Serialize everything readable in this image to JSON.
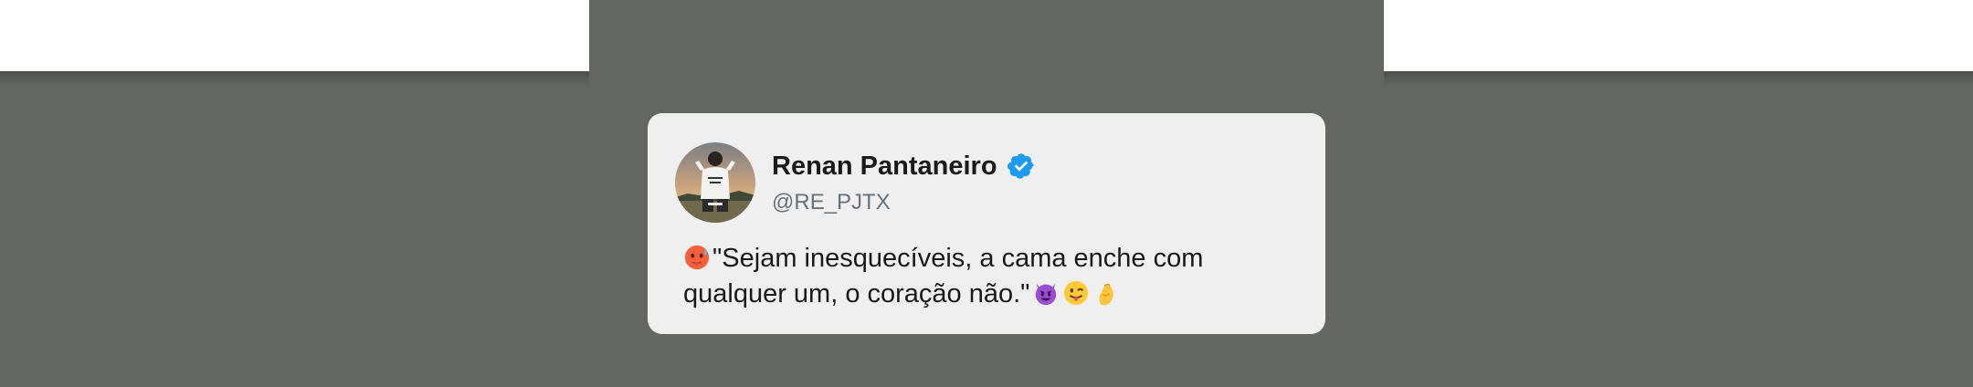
{
  "colors": {
    "background": "#646662",
    "card": "#efefef",
    "name": "#1a1a1a",
    "handle": "#677179",
    "verified_badge": "#1d9bf0"
  },
  "tweet_card": {
    "author_name": "Renan Pantaneiro",
    "author_handle": "@RE_PJTX",
    "verified": true,
    "text_line_1": "\"Sejam inesquecíveis, a cama enche com",
    "text_line_2": "qualquer um, o coração não.\"",
    "emojis": {
      "leading": "hot-face-emoji",
      "trailing": [
        "smiling-devil-emoji",
        "winking-tongue-face-emoji",
        "pinched-fingers-emoji"
      ]
    }
  }
}
